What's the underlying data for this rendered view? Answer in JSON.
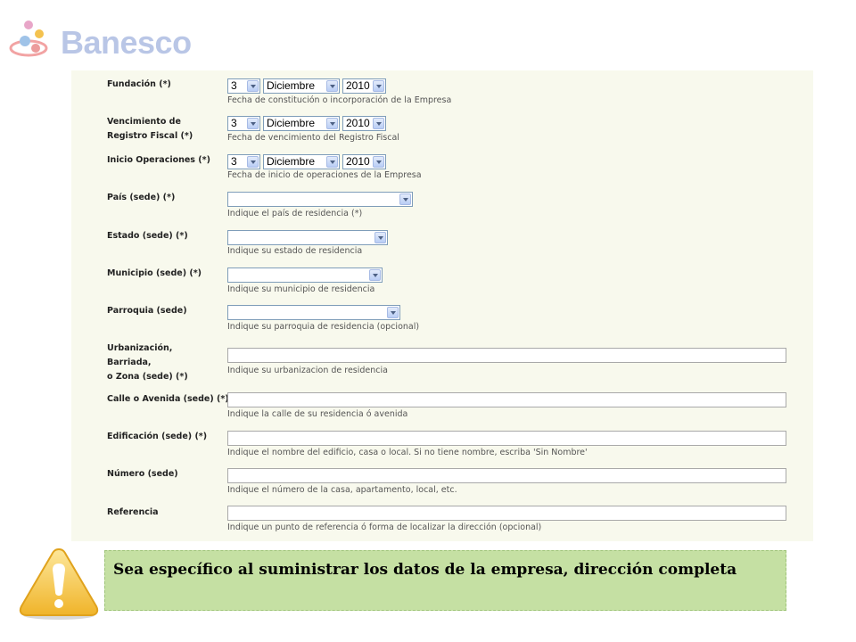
{
  "brand": {
    "name": "Banesco"
  },
  "rows": [
    {
      "label": "Fundación (*)",
      "day": "3",
      "month": "Diciembre",
      "year": "2010",
      "hint": "Fecha de constitución o incorporación de la Empresa"
    },
    {
      "label": "Vencimiento de\nRegistro Fiscal (*)",
      "day": "3",
      "month": "Diciembre",
      "year": "2010",
      "hint": "Fecha de vencimiento del Registro Fiscal"
    },
    {
      "label": "Inicio Operaciones (*)",
      "day": "3",
      "month": "Diciembre",
      "year": "2010",
      "hint": "Fecha de inicio de operaciones de la Empresa"
    },
    {
      "label": "País (sede) (*)",
      "value": "",
      "hint": "Indique el país de residencia (*)"
    },
    {
      "label": "Estado (sede) (*)",
      "value": "",
      "hint": "Indique su estado de residencia"
    },
    {
      "label": "Municipio (sede) (*)",
      "value": "",
      "hint": "Indique su municipio de residencia"
    },
    {
      "label": "Parroquia (sede)",
      "value": "",
      "hint": "Indique su parroquia de residencia (opcional)"
    },
    {
      "label": "Urbanización,\nBarriada,\no Zona (sede) (*)",
      "value": "",
      "hint": "Indique su urbanizacion de residencia"
    },
    {
      "label": "Calle o Avenida (sede) (*)",
      "value": "",
      "hint": "Indique la calle de su residencia ó avenida"
    },
    {
      "label": "Edificación (sede) (*)",
      "value": "",
      "hint": "Indique el nombre del edificio, casa o local. Si no tiene nombre, escriba 'Sin Nombre'"
    },
    {
      "label": "Número (sede)",
      "value": "",
      "hint": "Indique el número de la casa, apartamento, local, etc."
    },
    {
      "label": "Referencia",
      "value": "",
      "hint": "Indique un punto de referencia ó forma de localizar la dirección (opcional)"
    }
  ],
  "note": {
    "text": "Sea específico al suministrar los datos de la empresa, dirección completa"
  },
  "colors": {
    "panel": "#f8f9ed",
    "note_bg": "#c5e0a3",
    "brand": "#b9c6e6",
    "warning": "#f5c94a"
  },
  "icons": {
    "warning": "warning-icon",
    "logo": "banesco-logo-icon"
  }
}
